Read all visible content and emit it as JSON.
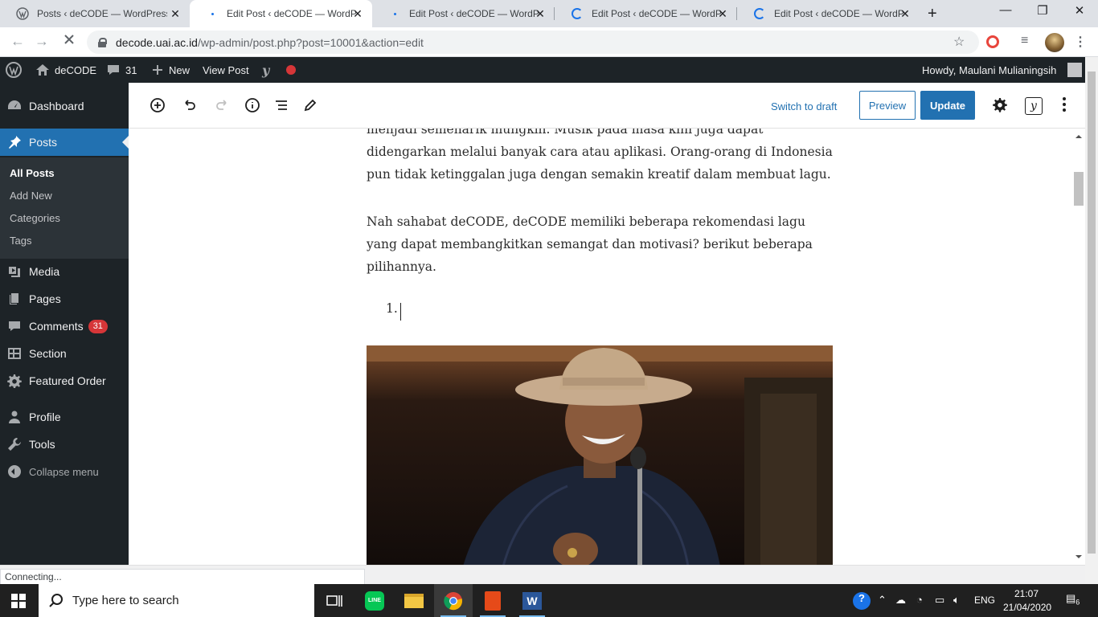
{
  "browser": {
    "tabs": [
      {
        "title": "Posts ‹ deCODE — WordPress",
        "state": "inactive"
      },
      {
        "title": "Edit Post ‹ deCODE — WordPress",
        "state": "active"
      },
      {
        "title": "Edit Post ‹ deCODE — WordPress",
        "state": "inactive"
      },
      {
        "title": "Edit Post ‹ deCODE — WordPress",
        "state": "loading"
      },
      {
        "title": "Edit Post ‹ deCODE — WordPress",
        "state": "loading"
      }
    ],
    "url_host": "decode.uai.ac.id",
    "url_path": "/wp-admin/post.php?post=10001&action=edit",
    "status_text": "Connecting..."
  },
  "adminbar": {
    "site_name": "deCODE",
    "comments_count": "31",
    "new_label": "New",
    "view_post_label": "View Post",
    "howdy": "Howdy, Maulani Mulianingsih"
  },
  "sidebar": {
    "items": [
      {
        "label": "Dashboard",
        "icon": "dashboard-icon"
      },
      {
        "label": "Posts",
        "icon": "pin-icon"
      },
      {
        "label": "Media",
        "icon": "media-icon"
      },
      {
        "label": "Pages",
        "icon": "pages-icon"
      },
      {
        "label": "Comments",
        "icon": "comment-icon",
        "badge": "31"
      },
      {
        "label": "Section",
        "icon": "section-icon"
      },
      {
        "label": "Featured Order",
        "icon": "gear-icon"
      },
      {
        "label": "Profile",
        "icon": "user-icon"
      },
      {
        "label": "Tools",
        "icon": "wrench-icon"
      },
      {
        "label": "Collapse menu",
        "icon": "collapse-icon"
      }
    ],
    "submenu": [
      "All Posts",
      "Add New",
      "Categories",
      "Tags"
    ]
  },
  "editor": {
    "switch_to_draft": "Switch to draft",
    "preview": "Preview",
    "update": "Update",
    "paragraph1": "menjadi semenarik mungkin. Musik pada masa kini juga dapat didengarkan melalui banyak cara atau aplikasi. Orang-orang di Indonesia pun tidak ketinggalan juga dengan semakin kreatif dalam membuat lagu.",
    "paragraph2": "Nah sahabat deCODE, deCODE memiliki beberapa rekomendasi lagu yang dapat membangkitkan semangat dan motivasi? berikut beberapa pilihannya.",
    "list_number": "1."
  },
  "taskbar": {
    "search_placeholder": "Type here to search",
    "language": "ENG",
    "time": "21:07",
    "date": "21/04/2020",
    "notification_count": "6"
  },
  "colors": {
    "wp_admin_dark": "#1d2327",
    "wp_blue": "#2271b1",
    "badge_red": "#d63638"
  }
}
